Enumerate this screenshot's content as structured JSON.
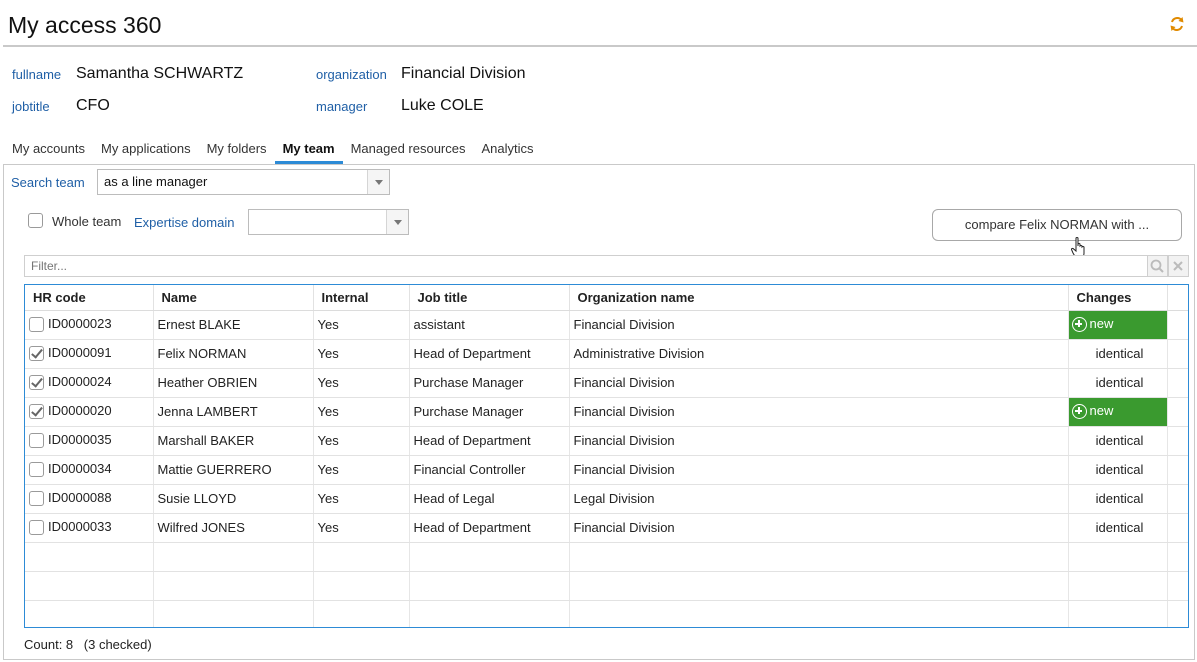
{
  "header": {
    "title": "My access 360",
    "refresh_icon": "refresh-icon"
  },
  "person": {
    "fullname_label": "fullname",
    "fullname": "Samantha SCHWARTZ",
    "jobtitle_label": "jobtitle",
    "jobtitle": "CFO",
    "organization_label": "organization",
    "organization": "Financial Division",
    "manager_label": "manager",
    "manager": "Luke COLE"
  },
  "tabs": [
    {
      "label": "My accounts"
    },
    {
      "label": "My applications"
    },
    {
      "label": "My folders"
    },
    {
      "label": "My team",
      "active": true
    },
    {
      "label": "Managed resources"
    },
    {
      "label": "Analytics"
    }
  ],
  "search": {
    "label": "Search team",
    "value": "as a line manager",
    "whole_team_label": "Whole team",
    "whole_team_checked": false,
    "expertise_label": "Expertise domain",
    "expertise_value": ""
  },
  "compare_button": "compare Felix NORMAN with ...",
  "filter": {
    "placeholder": "Filter..."
  },
  "table": {
    "columns": [
      "HR code",
      "Name",
      "Internal",
      "Job title",
      "Organization name",
      "Changes"
    ],
    "rows": [
      {
        "checked": false,
        "hr": "ID0000023",
        "name": "Ernest BLAKE",
        "internal": "Yes",
        "job": "assistant",
        "org": "Financial Division",
        "change": "new"
      },
      {
        "checked": true,
        "hr": "ID0000091",
        "name": "Felix NORMAN",
        "internal": "Yes",
        "job": "Head of Department",
        "org": "Administrative Division",
        "change": "identical"
      },
      {
        "checked": true,
        "hr": "ID0000024",
        "name": "Heather OBRIEN",
        "internal": "Yes",
        "job": "Purchase Manager",
        "org": "Financial Division",
        "change": "identical"
      },
      {
        "checked": true,
        "hr": "ID0000020",
        "name": "Jenna LAMBERT",
        "internal": "Yes",
        "job": "Purchase Manager",
        "org": "Financial Division",
        "change": "new"
      },
      {
        "checked": false,
        "hr": "ID0000035",
        "name": "Marshall BAKER",
        "internal": "Yes",
        "job": "Head of Department",
        "org": "Financial Division",
        "change": "identical"
      },
      {
        "checked": false,
        "hr": "ID0000034",
        "name": "Mattie GUERRERO",
        "internal": "Yes",
        "job": "Financial Controller",
        "org": "Financial Division",
        "change": "identical"
      },
      {
        "checked": false,
        "hr": "ID0000088",
        "name": "Susie LLOYD",
        "internal": "Yes",
        "job": "Head of Legal",
        "org": "Legal Division",
        "change": "identical"
      },
      {
        "checked": false,
        "hr": "ID0000033",
        "name": "Wilfred JONES",
        "internal": "Yes",
        "job": "Head of Department",
        "org": "Financial Division",
        "change": "identical"
      }
    ],
    "empty_rows": 3
  },
  "footer": {
    "count": "Count: 8",
    "checked": "(3 checked)"
  },
  "colors": {
    "accent": "#2d8bd6",
    "label_blue": "#1f5fa6",
    "new_green": "#3a9a2f"
  }
}
